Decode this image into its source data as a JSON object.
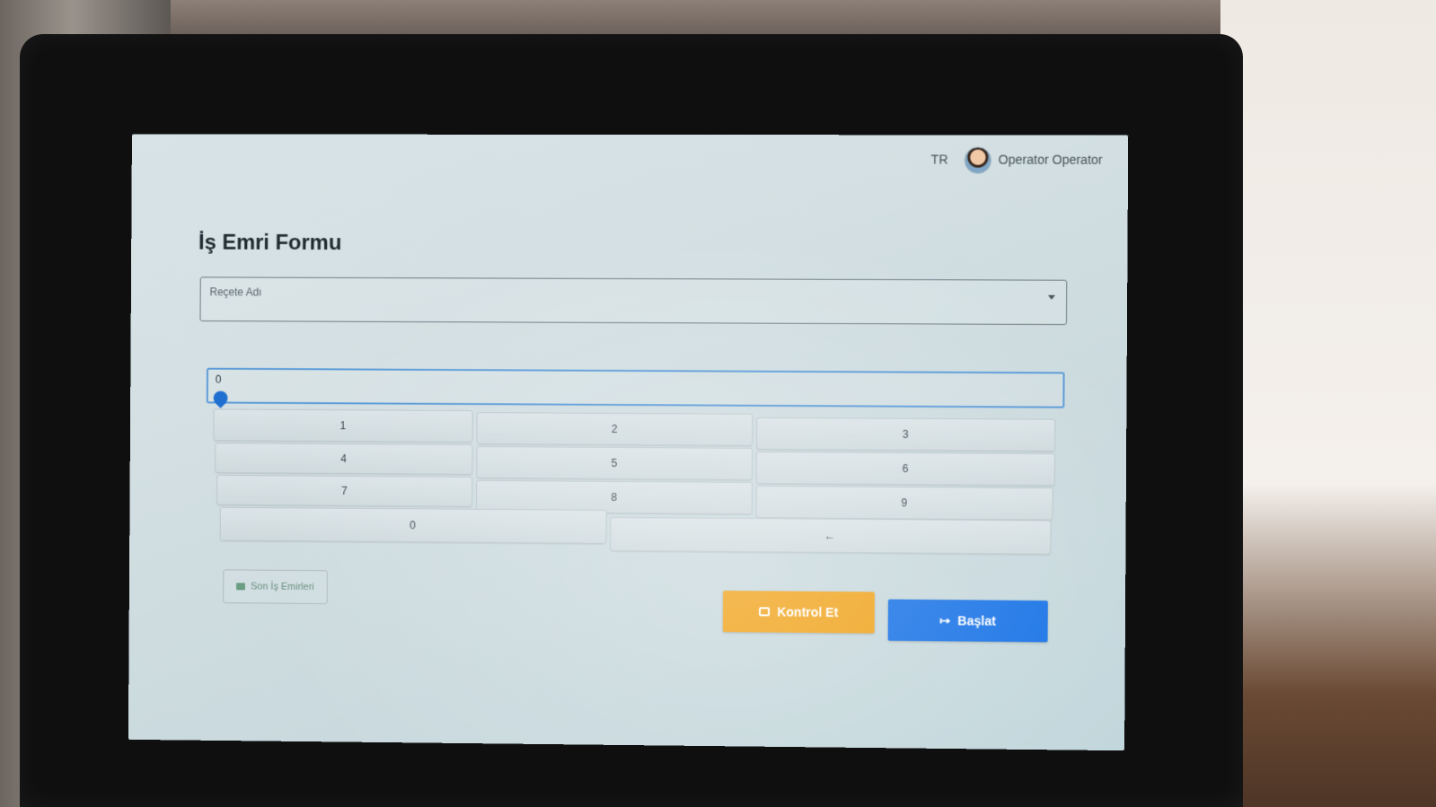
{
  "header": {
    "language": "TR",
    "user_name": "Operator Operator",
    "avatar_icon": "user-avatar-icon"
  },
  "form": {
    "title": "İş Emri Formu",
    "recipe_select": {
      "label": "Reçete Adı",
      "value": ""
    },
    "quantity_value": "0"
  },
  "keypad": {
    "keys": [
      "1",
      "2",
      "3",
      "4",
      "5",
      "6",
      "7",
      "8",
      "9",
      "0",
      "←"
    ]
  },
  "actions": {
    "history_label": "Son İş Emirleri",
    "check_label": "Kontrol Et",
    "start_label": "Başlat"
  },
  "colors": {
    "check_button": "#f0a41e",
    "start_button": "#1973e6",
    "input_focus": "#5b9bd8"
  }
}
